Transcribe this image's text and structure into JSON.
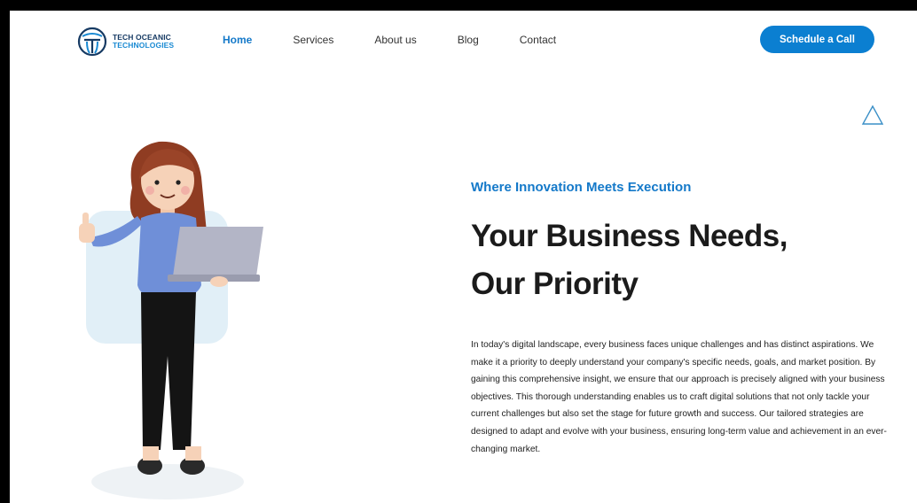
{
  "logo": {
    "line1": "TECH OCEANIC",
    "line2": "TECHNOLOGIES"
  },
  "nav": {
    "items": [
      {
        "label": "Home",
        "active": true
      },
      {
        "label": "Services",
        "active": false
      },
      {
        "label": "About us",
        "active": false
      },
      {
        "label": "Blog",
        "active": false
      },
      {
        "label": "Contact",
        "active": false
      }
    ],
    "cta_label": "Schedule a Call"
  },
  "hero": {
    "tagline": "Where Innovation Meets Execution",
    "headline_line1": "Your Business Needs,",
    "headline_line2": "Our Priority",
    "body": "In today's digital landscape, every business faces unique challenges and has distinct aspirations. We make it a priority to deeply understand your company's specific needs, goals, and market position. By gaining this comprehensive insight, we ensure that our approach is precisely aligned with your business objectives. This thorough understanding enables us to craft digital solutions that not only tackle your current challenges but also set the stage for future growth and success. Our tailored strategies are designed to adapt and evolve with your business, ensuring long-term value and achievement in an ever-changing market."
  },
  "colors": {
    "accent": "#0b7fd1",
    "brand_dark": "#163a63",
    "text": "#1b1b1b"
  }
}
